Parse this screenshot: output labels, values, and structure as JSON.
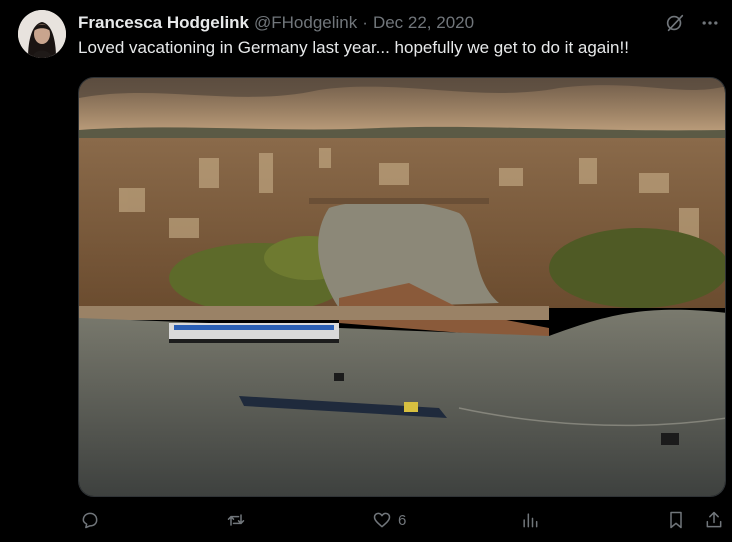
{
  "tweet": {
    "author_name": "Francesca Hodgelink",
    "handle": "@FHodgelink",
    "separator": "·",
    "date": "Dec 22, 2020",
    "text": "Loved vacationing in Germany last year... hopefully we get to do it again!!"
  },
  "actions": {
    "likes": "6"
  },
  "icons": {
    "grok": "grok-icon",
    "more": "more-icon",
    "reply": "reply-icon",
    "retweet": "retweet-icon",
    "like": "heart-icon",
    "views": "views-icon",
    "bookmark": "bookmark-icon",
    "share": "share-icon"
  }
}
